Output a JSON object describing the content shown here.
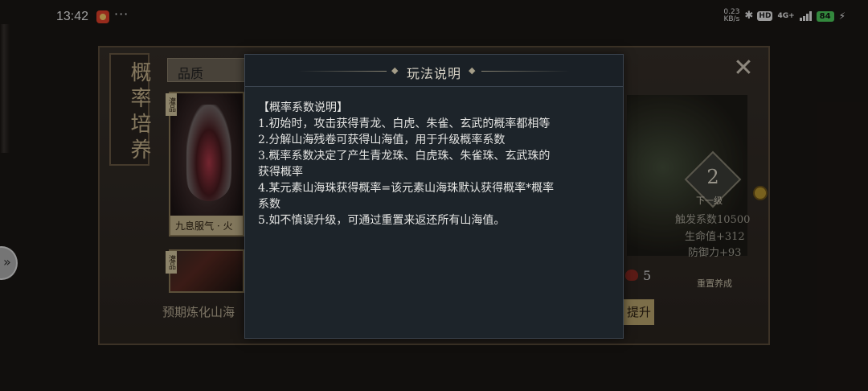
{
  "status_bar": {
    "time": "13:42",
    "dots": "···",
    "speed_value": "0.23",
    "speed_unit": "KB/s",
    "hd": "HD",
    "network": "4G+",
    "battery": "84"
  },
  "game": {
    "side_tab": "概率培养",
    "quality_label": "品质",
    "card_name": "九息服气 · 火",
    "card_tag_top": "灌品",
    "card_tag_bottom": "灌品",
    "expect_text": "预期炼化山海",
    "level": "2",
    "next_level": "下一级",
    "stat_trigger": "触发系数10500",
    "stat_hp": "生命值+312",
    "stat_def": "防御力+93",
    "count": "5",
    "reset": "重置养成",
    "upgrade": "提升",
    "close": "✕"
  },
  "modal": {
    "title": "玩法说明",
    "lines": [
      "【概率系数说明】",
      "1.初始时，攻击获得青龙、白虎、朱雀、玄武的概率都相等",
      "2.分解山海残卷可获得山海值，用于升级概率系数",
      "3.概率系数决定了产生青龙珠、白虎珠、朱雀珠、玄武珠的",
      "获得概率",
      "4.某元素山海珠获得概率=该元素山海珠默认获得概率*概率",
      "系数",
      "5.如不慎误升级，可通过重置来返还所有山海值。"
    ]
  }
}
